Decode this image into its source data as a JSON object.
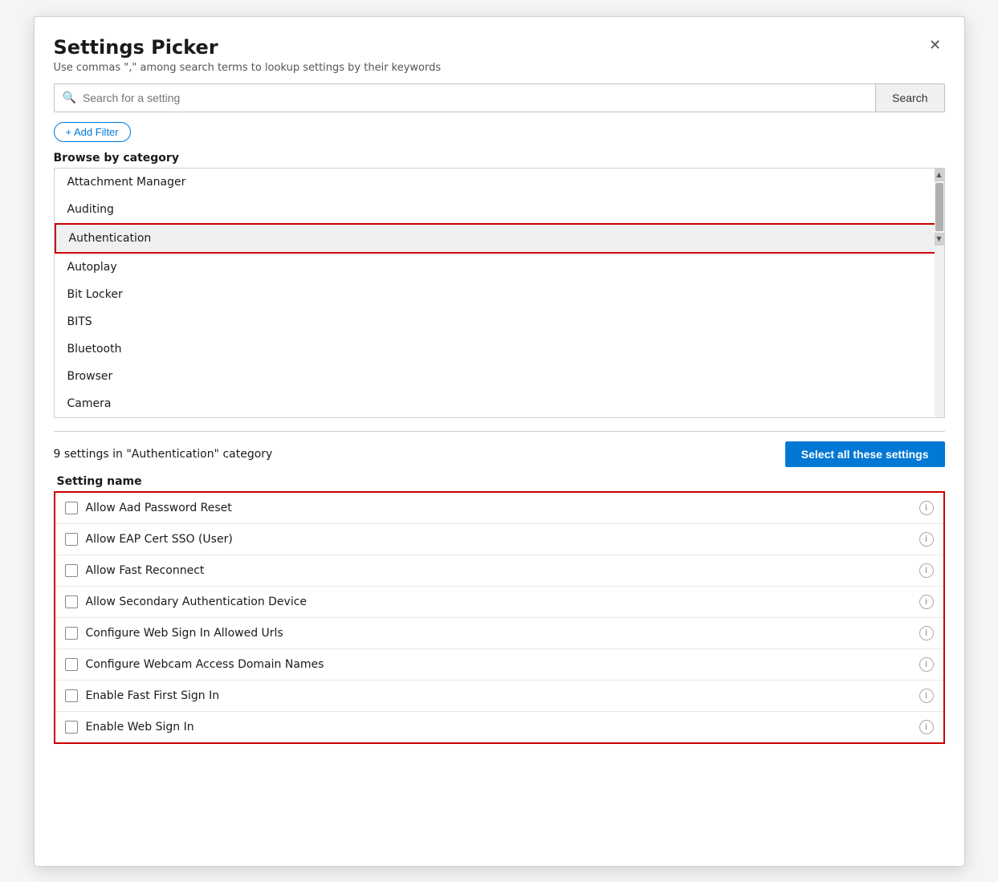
{
  "dialog": {
    "title": "Settings Picker",
    "subtitle": "Use commas \",\" among search terms to lookup settings by their keywords",
    "close_label": "×"
  },
  "search": {
    "placeholder": "Search for a setting",
    "button_label": "Search"
  },
  "filter": {
    "button_label": "+ Add Filter"
  },
  "browse": {
    "title": "Browse by category",
    "categories": [
      {
        "id": "attachment-manager",
        "label": "Attachment Manager",
        "selected": false
      },
      {
        "id": "auditing",
        "label": "Auditing",
        "selected": false
      },
      {
        "id": "authentication",
        "label": "Authentication",
        "selected": true
      },
      {
        "id": "autoplay",
        "label": "Autoplay",
        "selected": false
      },
      {
        "id": "bitlocker",
        "label": "Bit Locker",
        "selected": false
      },
      {
        "id": "bits",
        "label": "BITS",
        "selected": false
      },
      {
        "id": "bluetooth",
        "label": "Bluetooth",
        "selected": false
      },
      {
        "id": "browser",
        "label": "Browser",
        "selected": false
      },
      {
        "id": "camera",
        "label": "Camera",
        "selected": false
      }
    ]
  },
  "settings_section": {
    "count_text": "9 settings in \"Authentication\" category",
    "select_all_label": "Select all these settings",
    "column_header": "Setting name",
    "items": [
      {
        "id": "allow-aad",
        "label": "Allow Aad Password Reset",
        "checked": false
      },
      {
        "id": "allow-eap",
        "label": "Allow EAP Cert SSO (User)",
        "checked": false
      },
      {
        "id": "allow-fast",
        "label": "Allow Fast Reconnect",
        "checked": false
      },
      {
        "id": "allow-secondary",
        "label": "Allow Secondary Authentication Device",
        "checked": false
      },
      {
        "id": "configure-web-sign",
        "label": "Configure Web Sign In Allowed Urls",
        "checked": false
      },
      {
        "id": "configure-webcam",
        "label": "Configure Webcam Access Domain Names",
        "checked": false
      },
      {
        "id": "enable-fast-sign",
        "label": "Enable Fast First Sign In",
        "checked": false
      },
      {
        "id": "enable-web-sign",
        "label": "Enable Web Sign In",
        "checked": false
      }
    ]
  }
}
